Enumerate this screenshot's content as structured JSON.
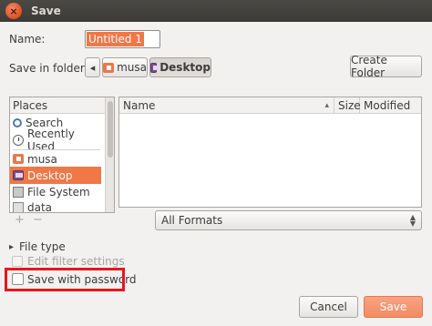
{
  "window": {
    "title": "Save"
  },
  "name_label": "Name:",
  "name_value": "Untitled 1",
  "save_in_label": "Save in folder:",
  "path": {
    "back_arrow": "◂",
    "items": [
      "musa",
      "Desktop"
    ]
  },
  "create_folder": "Create Folder",
  "places": {
    "header": "Places",
    "items": [
      "Search",
      "Recently Used",
      "musa",
      "Desktop",
      "File System",
      "data"
    ],
    "selected": "Desktop",
    "add": "+",
    "remove": "−"
  },
  "files": {
    "columns": [
      "Name",
      "Size",
      "Modified"
    ],
    "sort_indicator": "▴"
  },
  "filter": {
    "selected": "All Formats"
  },
  "file_type": {
    "arrow": "▸",
    "label": "File type"
  },
  "edit_filter": "Edit filter settings",
  "save_password": {
    "label": "Save with password",
    "checked": false
  },
  "buttons": {
    "cancel": "Cancel",
    "save": "Save"
  },
  "colors": {
    "accent": "#f07746",
    "highlight": "#e8171c",
    "titlebar": "#3c3b37"
  },
  "icons": {
    "close": "close-icon"
  }
}
